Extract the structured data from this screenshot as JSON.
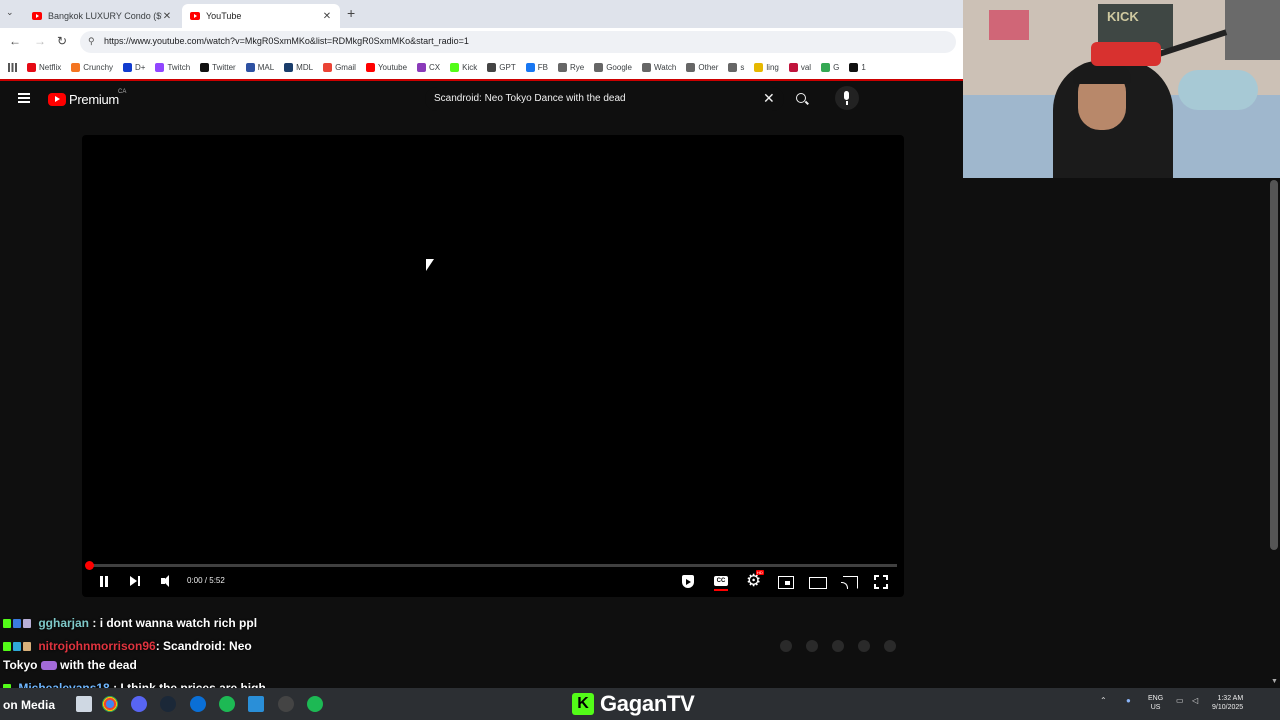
{
  "browser": {
    "tabs": [
      {
        "label": "Bangkok LUXURY Condo ($900...",
        "active": false
      },
      {
        "label": "YouTube",
        "active": true
      }
    ],
    "url": "https://www.youtube.com/watch?v=MkgR0SxmMKo&list=RDMkgR0SxmMKo&start_radio=1",
    "bookmarks": [
      {
        "label": "Netflix",
        "color": "#e50914"
      },
      {
        "label": "Crunchy",
        "color": "#f47521"
      },
      {
        "label": "D+",
        "color": "#113ccf"
      },
      {
        "label": "Twitch",
        "color": "#9146ff"
      },
      {
        "label": "Twitter",
        "color": "#111111"
      },
      {
        "label": "MAL",
        "color": "#2e51a2"
      },
      {
        "label": "MDL",
        "color": "#1a3d6b"
      },
      {
        "label": "Gmail",
        "color": "#ea4335"
      },
      {
        "label": "Youtube",
        "color": "#ff0000"
      },
      {
        "label": "CX",
        "color": "#8a3ab9"
      },
      {
        "label": "Kick",
        "color": "#53fc18"
      },
      {
        "label": "GPT",
        "color": "#444444"
      },
      {
        "label": "FB",
        "color": "#1877f2"
      },
      {
        "label": "Rye",
        "color": "#666666"
      },
      {
        "label": "Google",
        "color": "#666666"
      },
      {
        "label": "Watch",
        "color": "#666666"
      },
      {
        "label": "Other",
        "color": "#666666"
      },
      {
        "label": "s",
        "color": "#666666"
      },
      {
        "label": "ling",
        "color": "#e6b800"
      },
      {
        "label": "val",
        "color": "#c0143c"
      },
      {
        "label": "G",
        "color": "#34a853"
      },
      {
        "label": "1",
        "color": "#111111"
      }
    ]
  },
  "youtube": {
    "brand": "Premium",
    "region": "CA",
    "search_query": "Scandroid: Neo Tokyo Dance with the dead",
    "player": {
      "time": "0:00 / 5:52",
      "progress": 0
    }
  },
  "chat": [
    {
      "user": "ggharjan",
      "user_color": "#7ec8c8",
      "sep": " : ",
      "msg": "i dont wanna watch rich ppl"
    },
    {
      "user": "nitrojohnmorrison96",
      "user_color": "#e0343f",
      "sep": ": ",
      "msg_a": "Scandroid: Neo",
      "msg_b": "Tokyo",
      "msg_c": "with the dead"
    },
    {
      "user": "Michealevans18",
      "user_color": "#6fb7ff",
      "sep": " : ",
      "msg": "I think the prices are high",
      "msg2": "on Media"
    }
  ],
  "webcam": {
    "poster_text": "KICK"
  },
  "taskbar": {
    "channel": "GaganTV",
    "k_logo": "K",
    "lang_a": "ENG",
    "lang_b": "US",
    "time": "1:32 AM",
    "date": "9/10/2025"
  },
  "colors": {
    "accent": "#ff0000",
    "kick_green": "#53fc18"
  }
}
